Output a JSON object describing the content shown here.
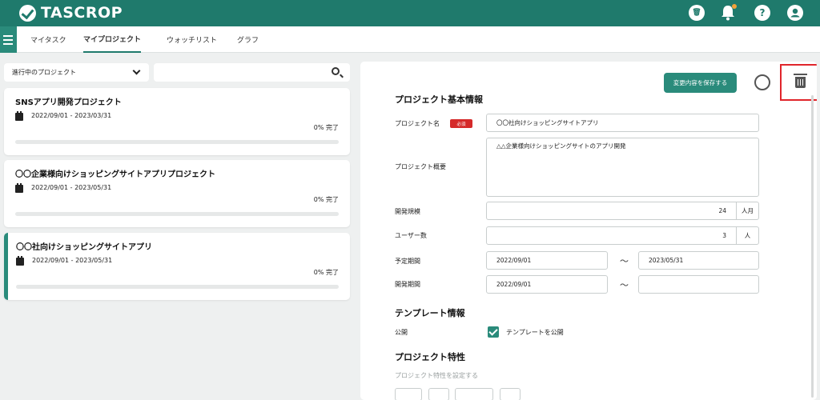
{
  "header": {
    "brand": "TASCROP",
    "icons": [
      "trash-circle-icon",
      "bell-icon",
      "help-icon",
      "user-icon"
    ],
    "help_glyph": "?",
    "accent": "#1f7a6c"
  },
  "nav": {
    "tabs": [
      {
        "label": "マイタスク",
        "active": false
      },
      {
        "label": "マイプロジェクト",
        "active": true
      },
      {
        "label": "ウォッチリスト",
        "active": false
      },
      {
        "label": "グラフ",
        "active": false
      }
    ]
  },
  "list": {
    "filter_selected": "進行中のプロジェクト",
    "search_placeholder": "",
    "projects": [
      {
        "title": "SNSアプリ開発プロジェクト",
        "dates": "2022/09/01 - 2023/03/31",
        "progress_label": "0% 完了",
        "progress": 0
      },
      {
        "title": "〇〇企業様向けショッピングサイトアプリプロジェクト",
        "dates": "2022/09/01 - 2023/05/31",
        "progress_label": "0% 完了",
        "progress": 0
      },
      {
        "title": "〇〇社向けショッピングサイトアプリ",
        "dates": "2022/09/01 - 2023/05/31",
        "progress_label": "0% 完了",
        "progress": 0,
        "selected": true
      }
    ]
  },
  "detail": {
    "save_label": "変更内容を保存する",
    "basic_title": "プロジェクト基本情報",
    "name_label": "プロジェクト名",
    "required_badge": "必須",
    "name_value": "〇〇社向けショッピングサイトアプリ",
    "summary_label": "プロジェクト概要",
    "summary_value": "△△企業様向けショッピングサイトのアプリ開発",
    "scale_label": "開発規模",
    "scale_value": "24",
    "scale_unit": "人月",
    "users_label": "ユーザー数",
    "users_value": "3",
    "users_unit": "人",
    "planned_label": "予定期間",
    "planned_start": "2022/09/01",
    "planned_end": "2023/05/31",
    "dev_label": "開発期間",
    "dev_start": "2022/09/01",
    "dev_end": "",
    "tilde": "～",
    "template_title": "テンプレート情報",
    "public_label": "公開",
    "publish_check_label": "テンプレートを公開",
    "traits_title": "プロジェクト特性",
    "traits_hint": "プロジェクト特性を設定する"
  }
}
